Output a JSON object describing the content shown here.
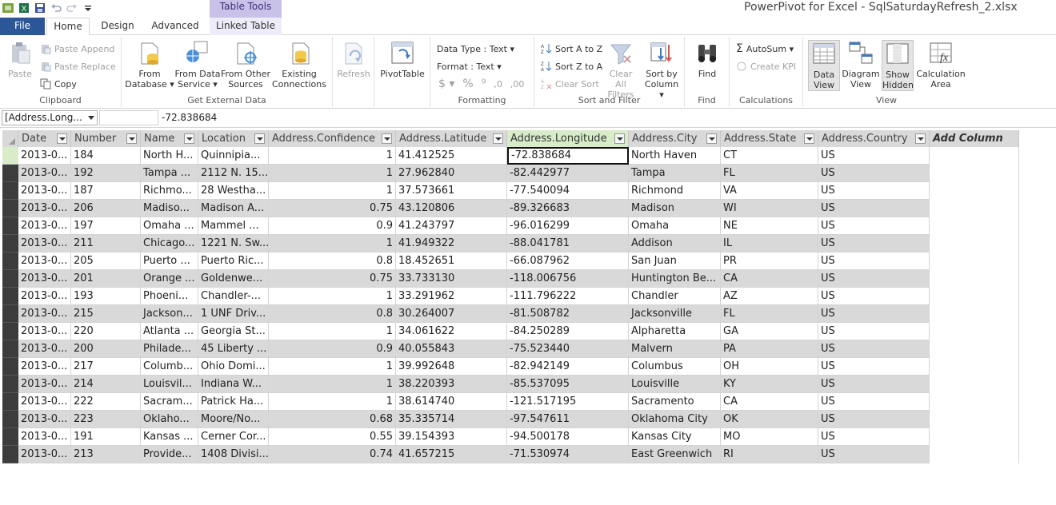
{
  "window": {
    "title": "PowerPivot for Excel - SqlSaturdayRefresh_2.xlsx",
    "context_tab": "Table Tools"
  },
  "tabs": [
    "File",
    "Home",
    "Design",
    "Advanced",
    "Linked Table"
  ],
  "ribbon": {
    "clipboard": {
      "label": "Clipboard",
      "paste": "Paste",
      "paste_append": "Paste Append",
      "paste_replace": "Paste Replace",
      "copy": "Copy"
    },
    "get_external": {
      "label": "Get External Data",
      "from_database": "From Database ▾",
      "from_data_service": "From Data Service ▾",
      "from_other": "From Other Sources",
      "existing": "Existing Connections"
    },
    "refresh": {
      "label": "Refresh"
    },
    "pivot": {
      "label": "PivotTable"
    },
    "formatting": {
      "label": "Formatting",
      "data_type": "Data Type : Text ▾",
      "format": "Format : Text ▾",
      "currency": "$ ▾",
      "percent": "%",
      "comma": "⁹",
      "inc_dec": ",0",
      "dec_dec": ",00"
    },
    "sort_filter": {
      "label": "Sort and Filter",
      "sort_az": "Sort A to Z",
      "sort_za": "Sort Z to A",
      "clear_sort": "Clear Sort",
      "clear_filters": "Clear All Filters",
      "sort_by_column": "Sort by Column ▾"
    },
    "find": {
      "label": "Find",
      "find": "Find"
    },
    "calculations": {
      "label": "Calculations",
      "autosum": "AutoSum ▾",
      "create_kpi": "Create KPI"
    },
    "view": {
      "label": "View",
      "data_view": "Data View",
      "diagram_view": "Diagram View",
      "show_hidden": "Show Hidden",
      "calc_area": "Calculation Area"
    }
  },
  "formula_bar": {
    "name_box": "[Address.Long...",
    "value": "-72.838684"
  },
  "grid": {
    "columns": [
      "Date",
      "Number",
      "Name",
      "Location",
      "Address.Confidence",
      "Address.Latitude",
      "Address.Longitude",
      "Address.City",
      "Address.State",
      "Address.Country"
    ],
    "add_column": "Add Column",
    "rows": [
      [
        "2013-0...",
        "184",
        "North H...",
        "Quinnipia...",
        "1",
        "41.412525",
        "-72.838684",
        "North Haven",
        "CT",
        "US"
      ],
      [
        "2013-0...",
        "192",
        "Tampa ...",
        "2112 N. 15...",
        "1",
        "27.962840",
        "-82.442977",
        "Tampa",
        "FL",
        "US"
      ],
      [
        "2013-0...",
        "187",
        "Richmo...",
        "28 Westha...",
        "1",
        "37.573661",
        "-77.540094",
        "Richmond",
        "VA",
        "US"
      ],
      [
        "2013-0...",
        "206",
        "Madiso...",
        "Madison A...",
        "0.75",
        "43.120806",
        "-89.326683",
        "Madison",
        "WI",
        "US"
      ],
      [
        "2013-0...",
        "197",
        "Omaha ...",
        "Mammel ...",
        "0.9",
        "41.243797",
        "-96.016299",
        "Omaha",
        "NE",
        "US"
      ],
      [
        "2013-0...",
        "211",
        "Chicago...",
        "1221 N. Sw...",
        "1",
        "41.949322",
        "-88.041781",
        "Addison",
        "IL",
        "US"
      ],
      [
        "2013-0...",
        "205",
        "Puerto ...",
        "Puerto Ric...",
        "0.8",
        "18.452651",
        "-66.087962",
        "San Juan",
        "PR",
        "US"
      ],
      [
        "2013-0...",
        "201",
        "Orange ...",
        "Goldenwe...",
        "0.75",
        "33.733130",
        "-118.006756",
        "Huntington Be...",
        "CA",
        "US"
      ],
      [
        "2013-0...",
        "193",
        "Phoeni...",
        "Chandler-...",
        "1",
        "33.291962",
        "-111.796222",
        "Chandler",
        "AZ",
        "US"
      ],
      [
        "2013-0...",
        "215",
        "Jackson...",
        "1 UNF Driv...",
        "0.8",
        "30.264007",
        "-81.508782",
        "Jacksonville",
        "FL",
        "US"
      ],
      [
        "2013-0...",
        "220",
        "Atlanta ...",
        "Georgia St...",
        "1",
        "34.061622",
        "-84.250289",
        "Alpharetta",
        "GA",
        "US"
      ],
      [
        "2013-0...",
        "200",
        "Philade...",
        "45 Liberty ...",
        "0.9",
        "40.055843",
        "-75.523440",
        "Malvern",
        "PA",
        "US"
      ],
      [
        "2013-0...",
        "217",
        "Columb...",
        "Ohio Domi...",
        "1",
        "39.992648",
        "-82.942149",
        "Columbus",
        "OH",
        "US"
      ],
      [
        "2013-0...",
        "214",
        "Louisvil...",
        "Indiana W...",
        "1",
        "38.220393",
        "-85.537095",
        "Louisville",
        "KY",
        "US"
      ],
      [
        "2013-0...",
        "222",
        "Sacram...",
        "Patrick Ha...",
        "1",
        "38.614740",
        "-121.517195",
        "Sacramento",
        "CA",
        "US"
      ],
      [
        "2013-0...",
        "223",
        "Oklaho...",
        "Moore/No...",
        "0.68",
        "35.335714",
        "-97.547611",
        "Oklahoma City",
        "OK",
        "US"
      ],
      [
        "2013-0...",
        "191",
        "Kansas ...",
        "Cerner Cor...",
        "0.55",
        "39.154393",
        "-94.500178",
        "Kansas City",
        "MO",
        "US"
      ],
      [
        "2013-0...",
        "213",
        "Provide...",
        "1408 Divisi...",
        "0.74",
        "41.657215",
        "-71.530974",
        "East Greenwich",
        "RI",
        "US"
      ]
    ],
    "selected_column": "Address.Longitude",
    "row_colors": [
      "#ffffff",
      "#d9d9d9"
    ]
  },
  "colors": {
    "file_tab": "#2b579a",
    "context_tab": "#c9c1e8",
    "selection": "#d8ecc9"
  },
  "icons": [
    "excel-icon",
    "save-icon",
    "undo-icon",
    "redo-icon",
    "customize-icon",
    "filter-dropdown-icon"
  ]
}
